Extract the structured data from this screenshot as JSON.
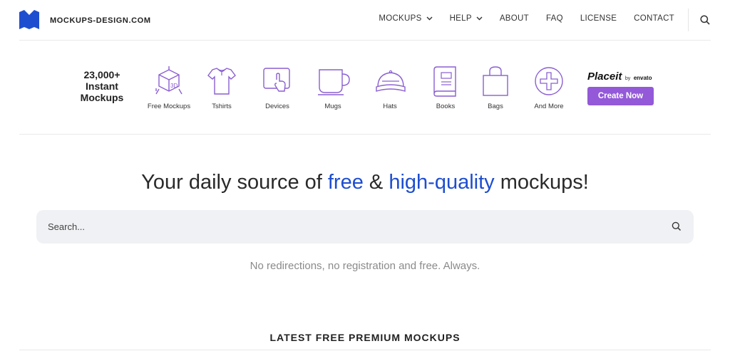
{
  "header": {
    "logo_text": "MOCKUPS-DESIGN.COM",
    "nav": [
      {
        "label": "MOCKUPS",
        "dropdown": true
      },
      {
        "label": "HELP",
        "dropdown": true
      },
      {
        "label": "ABOUT",
        "dropdown": false
      },
      {
        "label": "FAQ",
        "dropdown": false
      },
      {
        "label": "LICENSE",
        "dropdown": false
      },
      {
        "label": "CONTACT",
        "dropdown": false
      }
    ]
  },
  "categories": {
    "intro_line1": "23,000+",
    "intro_line2": "Instant",
    "intro_line3": "Mockups",
    "items": [
      {
        "label": "Free Mockups",
        "icon": "3d-box-icon"
      },
      {
        "label": "Tshirts",
        "icon": "tshirt-icon"
      },
      {
        "label": "Devices",
        "icon": "tablet-touch-icon"
      },
      {
        "label": "Mugs",
        "icon": "mug-icon"
      },
      {
        "label": "Hats",
        "icon": "cap-icon"
      },
      {
        "label": "Books",
        "icon": "book-icon"
      },
      {
        "label": "Bags",
        "icon": "bag-icon"
      },
      {
        "label": "And More",
        "icon": "plus-circle-icon"
      }
    ],
    "placeit_brand": "Placeit",
    "placeit_by": "by",
    "placeit_envato": "envato",
    "create_button": "Create Now"
  },
  "hero": {
    "part1": "Your daily source of ",
    "highlight1": "free",
    "part2": " & ",
    "highlight2": "high-quality",
    "part3": " mockups!"
  },
  "search": {
    "placeholder": "Search..."
  },
  "tagline": "No redirections, no registration and free. Always.",
  "section_title": "LATEST FREE PREMIUM MOCKUPS",
  "colors": {
    "accent_purple": "#9359d8",
    "icon_purple": "#8a5fd1",
    "brand_blue": "#1e4ed0"
  }
}
